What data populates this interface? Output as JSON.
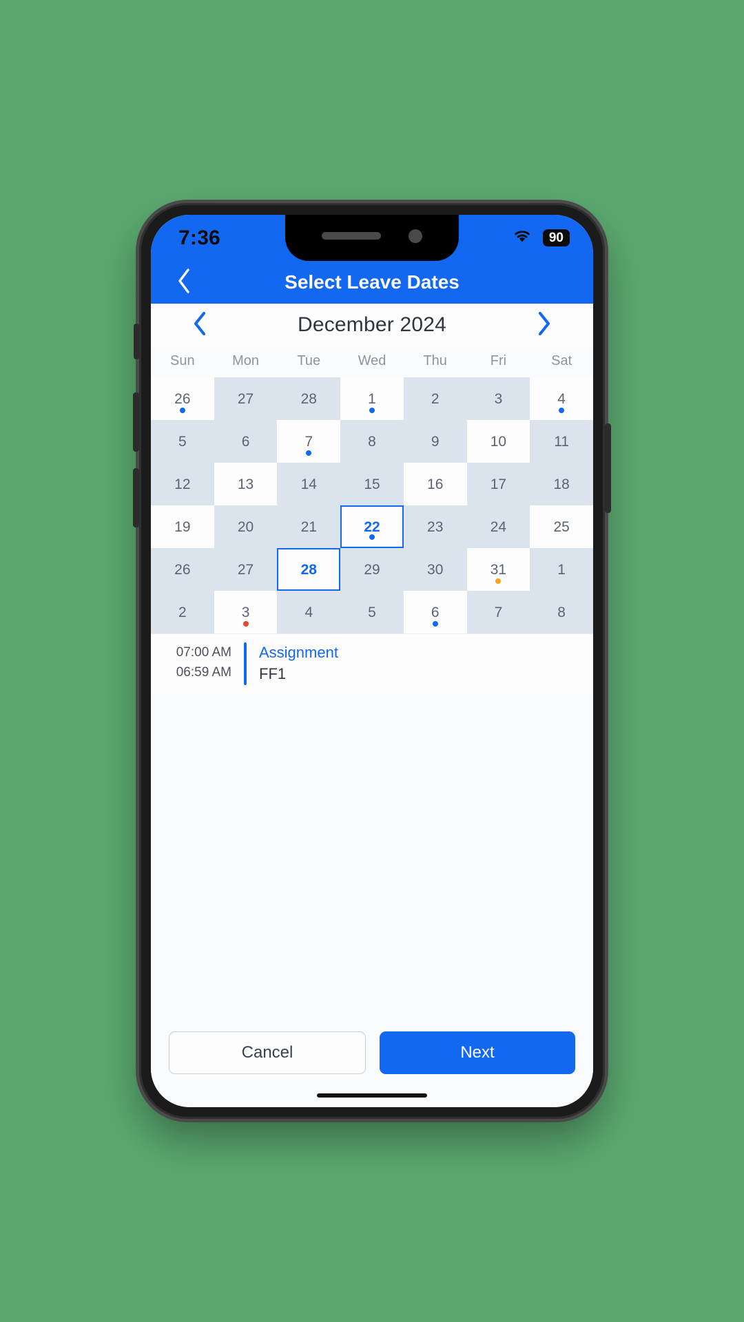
{
  "status": {
    "time": "7:36",
    "wifi_icon": "wifi-icon",
    "battery_level": "90"
  },
  "header": {
    "back_icon": "chevron-left-icon",
    "title": "Select Leave Dates"
  },
  "month_nav": {
    "prev_icon": "chevron-left-icon",
    "next_icon": "chevron-right-icon",
    "label": "December 2024"
  },
  "calendar": {
    "weekdays": [
      "Sun",
      "Mon",
      "Tue",
      "Wed",
      "Thu",
      "Fri",
      "Sat"
    ],
    "rows": [
      [
        {
          "day": "26",
          "shade": false,
          "dot": "#1268f0",
          "selected": false
        },
        {
          "day": "27",
          "shade": true,
          "dot": null,
          "selected": false
        },
        {
          "day": "28",
          "shade": true,
          "dot": null,
          "selected": false
        },
        {
          "day": "1",
          "shade": false,
          "dot": "#1268f0",
          "selected": false
        },
        {
          "day": "2",
          "shade": true,
          "dot": null,
          "selected": false
        },
        {
          "day": "3",
          "shade": true,
          "dot": null,
          "selected": false
        },
        {
          "day": "4",
          "shade": false,
          "dot": "#1268f0",
          "selected": false
        }
      ],
      [
        {
          "day": "5",
          "shade": true,
          "dot": null,
          "selected": false
        },
        {
          "day": "6",
          "shade": true,
          "dot": null,
          "selected": false
        },
        {
          "day": "7",
          "shade": false,
          "dot": "#1268f0",
          "selected": false
        },
        {
          "day": "8",
          "shade": true,
          "dot": null,
          "selected": false
        },
        {
          "day": "9",
          "shade": true,
          "dot": null,
          "selected": false
        },
        {
          "day": "10",
          "shade": false,
          "dot": null,
          "selected": false
        },
        {
          "day": "11",
          "shade": true,
          "dot": null,
          "selected": false
        }
      ],
      [
        {
          "day": "12",
          "shade": true,
          "dot": null,
          "selected": false
        },
        {
          "day": "13",
          "shade": false,
          "dot": null,
          "selected": false
        },
        {
          "day": "14",
          "shade": true,
          "dot": null,
          "selected": false
        },
        {
          "day": "15",
          "shade": true,
          "dot": null,
          "selected": false
        },
        {
          "day": "16",
          "shade": false,
          "dot": null,
          "selected": false
        },
        {
          "day": "17",
          "shade": true,
          "dot": null,
          "selected": false
        },
        {
          "day": "18",
          "shade": true,
          "dot": null,
          "selected": false
        }
      ],
      [
        {
          "day": "19",
          "shade": false,
          "dot": null,
          "selected": false
        },
        {
          "day": "20",
          "shade": true,
          "dot": null,
          "selected": false
        },
        {
          "day": "21",
          "shade": true,
          "dot": null,
          "selected": false
        },
        {
          "day": "22",
          "shade": false,
          "dot": "#1268f0",
          "selected": true
        },
        {
          "day": "23",
          "shade": true,
          "dot": null,
          "selected": false
        },
        {
          "day": "24",
          "shade": true,
          "dot": null,
          "selected": false
        },
        {
          "day": "25",
          "shade": false,
          "dot": null,
          "selected": false
        }
      ],
      [
        {
          "day": "26",
          "shade": true,
          "dot": null,
          "selected": false
        },
        {
          "day": "27",
          "shade": true,
          "dot": null,
          "selected": false
        },
        {
          "day": "28",
          "shade": false,
          "dot": null,
          "selected": true
        },
        {
          "day": "29",
          "shade": true,
          "dot": null,
          "selected": false
        },
        {
          "day": "30",
          "shade": true,
          "dot": null,
          "selected": false
        },
        {
          "day": "31",
          "shade": false,
          "dot": "#f5a623",
          "selected": false
        },
        {
          "day": "1",
          "shade": true,
          "dot": null,
          "selected": false
        }
      ],
      [
        {
          "day": "2",
          "shade": true,
          "dot": null,
          "selected": false
        },
        {
          "day": "3",
          "shade": false,
          "dot": "#e8482b",
          "selected": false
        },
        {
          "day": "4",
          "shade": true,
          "dot": null,
          "selected": false
        },
        {
          "day": "5",
          "shade": true,
          "dot": null,
          "selected": false
        },
        {
          "day": "6",
          "shade": false,
          "dot": "#1268f0",
          "selected": false
        },
        {
          "day": "7",
          "shade": true,
          "dot": null,
          "selected": false
        },
        {
          "day": "8",
          "shade": true,
          "dot": null,
          "selected": false
        }
      ]
    ]
  },
  "event": {
    "start_time": "07:00 AM",
    "end_time": "06:59 AM",
    "title": "Assignment",
    "subtitle": "FF1"
  },
  "footer": {
    "cancel_label": "Cancel",
    "next_label": "Next"
  },
  "colors": {
    "brand_blue": "#1268f0",
    "cell_shade": "#dbe3ec",
    "dot_blue": "#1268f0",
    "dot_orange": "#f5a623",
    "dot_red": "#e8482b"
  }
}
